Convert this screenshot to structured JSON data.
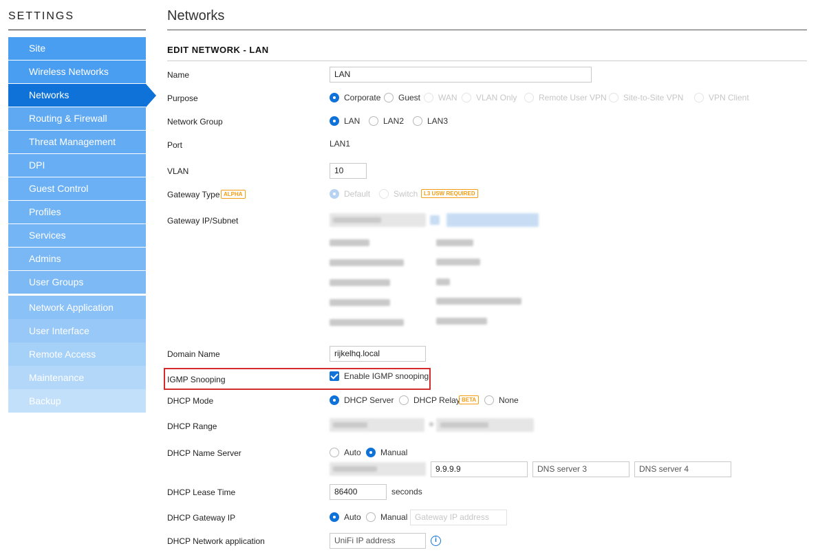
{
  "sidebar": {
    "title": "SETTINGS",
    "items": [
      {
        "label": "Site"
      },
      {
        "label": "Wireless Networks"
      },
      {
        "label": "Networks",
        "active": true
      },
      {
        "label": "Routing & Firewall"
      },
      {
        "label": "Threat Management"
      },
      {
        "label": "DPI"
      },
      {
        "label": "Guest Control"
      },
      {
        "label": "Profiles"
      },
      {
        "label": "Services"
      },
      {
        "label": "Admins"
      },
      {
        "label": "User Groups"
      }
    ],
    "items2": [
      {
        "label": "Network Application"
      },
      {
        "label": "User Interface"
      },
      {
        "label": "Remote Access"
      },
      {
        "label": "Maintenance"
      },
      {
        "label": "Backup"
      }
    ]
  },
  "page": {
    "title": "Networks",
    "section": "EDIT NETWORK - LAN"
  },
  "form": {
    "name": {
      "label": "Name",
      "value": "LAN"
    },
    "purpose": {
      "label": "Purpose",
      "options": [
        "Corporate",
        "Guest",
        "WAN",
        "VLAN Only",
        "Remote User VPN",
        "Site-to-Site VPN",
        "VPN Client"
      ],
      "selected": "Corporate"
    },
    "network_group": {
      "label": "Network Group",
      "options": [
        "LAN",
        "LAN2",
        "LAN3"
      ],
      "selected": "LAN"
    },
    "port": {
      "label": "Port",
      "value": "LAN1"
    },
    "vlan": {
      "label": "VLAN",
      "value": "10"
    },
    "gateway_type": {
      "label": "Gateway Type",
      "badge": "ALPHA",
      "options": [
        "Default",
        "Switch"
      ],
      "selected": "Default",
      "switch_badge": "L3 USW REQUIRED"
    },
    "gateway_ip": {
      "label": "Gateway IP/Subnet"
    },
    "domain_name": {
      "label": "Domain Name",
      "value": "rijkelhq.local"
    },
    "igmp": {
      "label": "IGMP Snooping",
      "checkbox_label": "Enable IGMP snooping",
      "checked": true
    },
    "dhcp_mode": {
      "label": "DHCP Mode",
      "options": [
        "DHCP Server",
        "DHCP Relay",
        "None"
      ],
      "selected": "DHCP Server",
      "relay_badge": "BETA"
    },
    "dhcp_range": {
      "label": "DHCP Range"
    },
    "dhcp_name_server": {
      "label": "DHCP Name Server",
      "options": [
        "Auto",
        "Manual"
      ],
      "selected": "Manual",
      "dns2": "9.9.9.9",
      "dns3_placeholder": "DNS server 3",
      "dns4_placeholder": "DNS server 4"
    },
    "dhcp_lease": {
      "label": "DHCP Lease Time",
      "value": "86400",
      "unit": "seconds"
    },
    "dhcp_gateway": {
      "label": "DHCP Gateway IP",
      "options": [
        "Auto",
        "Manual"
      ],
      "selected": "Auto",
      "placeholder": "Gateway IP address"
    },
    "dhcp_network_app": {
      "label": "DHCP Network application",
      "placeholder": "UniFi IP address"
    }
  },
  "colors": {
    "accent": "#0f72d8",
    "highlight": "#d12b2b",
    "badge": "#f39c12"
  }
}
